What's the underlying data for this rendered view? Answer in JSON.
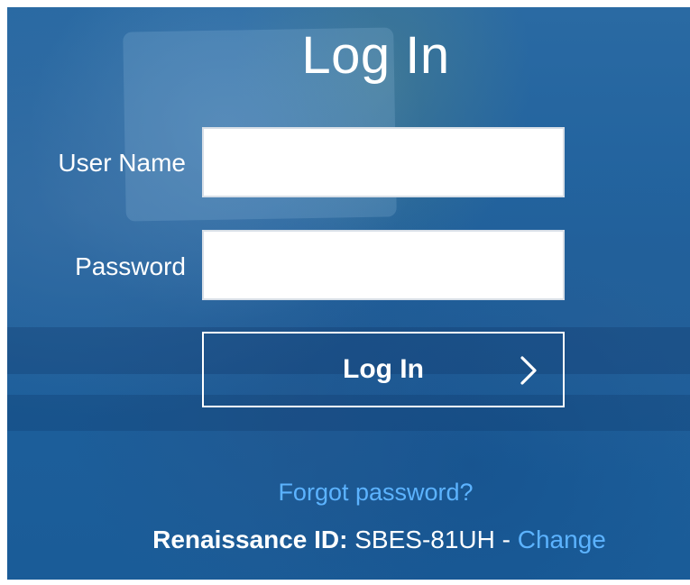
{
  "page": {
    "title": "Log In"
  },
  "form": {
    "username_label": "User Name",
    "username_value": "",
    "password_label": "Password",
    "password_value": "",
    "submit_label": "Log In"
  },
  "links": {
    "forgot_password": "Forgot password?"
  },
  "renaissance": {
    "label": "Renaissance ID:",
    "id_value": "SBES-81UH",
    "separator": "-",
    "change_label": "Change"
  },
  "icons": {
    "submit_chevron": "chevron-right-icon"
  },
  "colors": {
    "panel_blue": "#1c5f99",
    "link_blue": "#5cb3ff",
    "text_white": "#ffffff",
    "input_bg": "#ffffff",
    "input_border": "#d8dfe7"
  }
}
